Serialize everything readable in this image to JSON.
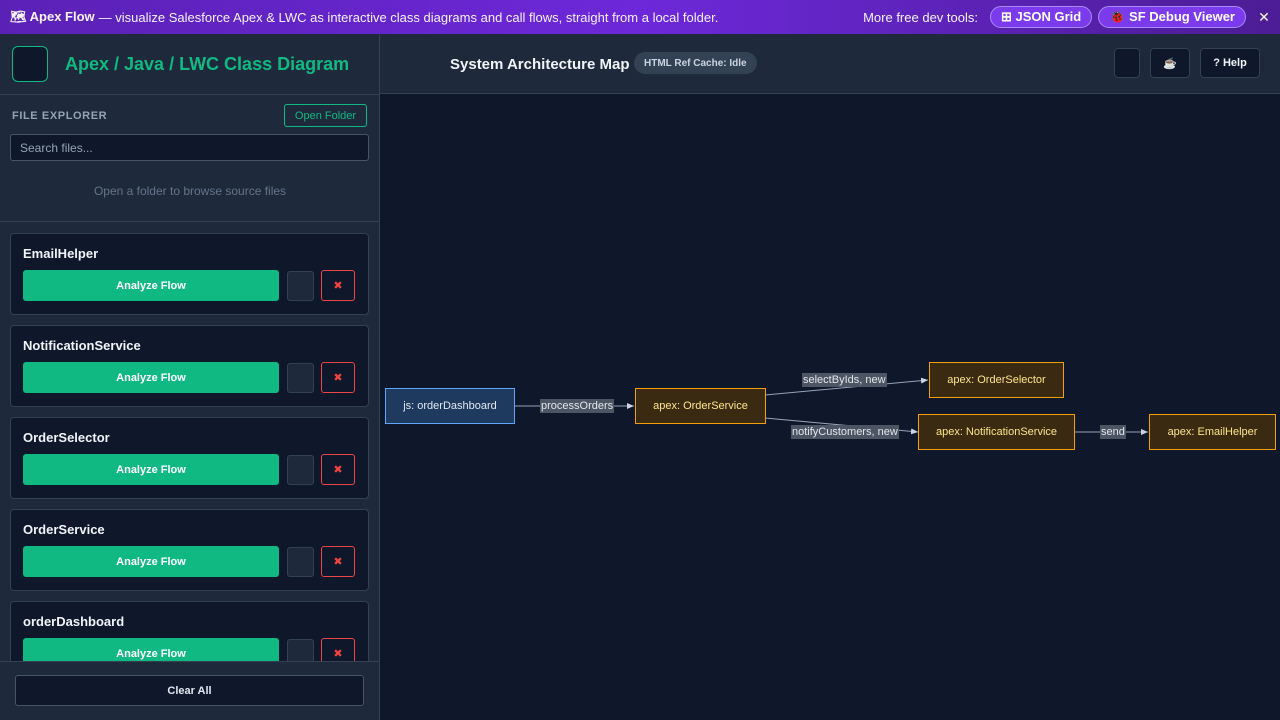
{
  "banner": {
    "brand": "🗺 Apex Flow",
    "tagline": "— visualize Salesforce Apex & LWC as interactive class diagrams and call flows, straight from a local folder.",
    "more_label": "More free dev tools:",
    "json_grid_label": "⊞ JSON Grid",
    "sf_debug_label": "🐞 SF Debug Viewer",
    "close_glyph": "✕"
  },
  "sidebar": {
    "title": "Apex / Java / LWC Class Diagram",
    "explorer_label": "FILE EXPLORER",
    "open_folder_label": "Open Folder",
    "search_placeholder": "Search files...",
    "empty_message": "Open a folder to browse source files",
    "analyze_label": "Analyze Flow",
    "delete_glyph": "✖",
    "cards": [
      {
        "name": "EmailHelper"
      },
      {
        "name": "NotificationService"
      },
      {
        "name": "OrderSelector"
      },
      {
        "name": "OrderService"
      },
      {
        "name": "orderDashboard"
      }
    ],
    "clear_all_label": "Clear All"
  },
  "main": {
    "title": "System Architecture Map",
    "cache_badge": "HTML Ref Cache: Idle",
    "coffee_glyph": "☕",
    "help_label": "? Help"
  },
  "diagram": {
    "nodes": [
      {
        "id": "n1",
        "label": "js: orderDashboard",
        "kind": "js"
      },
      {
        "id": "n2",
        "label": "apex: OrderService",
        "kind": "apex"
      },
      {
        "id": "n3",
        "label": "apex: OrderSelector",
        "kind": "apex"
      },
      {
        "id": "n4",
        "label": "apex: NotificationService",
        "kind": "apex"
      },
      {
        "id": "n5",
        "label": "apex: EmailHelper",
        "kind": "apex"
      }
    ],
    "edges": [
      {
        "from": "n1",
        "to": "n2",
        "label": "processOrders"
      },
      {
        "from": "n2",
        "to": "n3",
        "label": "selectByIds, new"
      },
      {
        "from": "n2",
        "to": "n4",
        "label": "notifyCustomers, new"
      },
      {
        "from": "n4",
        "to": "n5",
        "label": "send"
      }
    ],
    "colors": {
      "js_border": "#60a5fa",
      "apex_border": "#f59e0b",
      "edge": "#94a3b8"
    }
  }
}
